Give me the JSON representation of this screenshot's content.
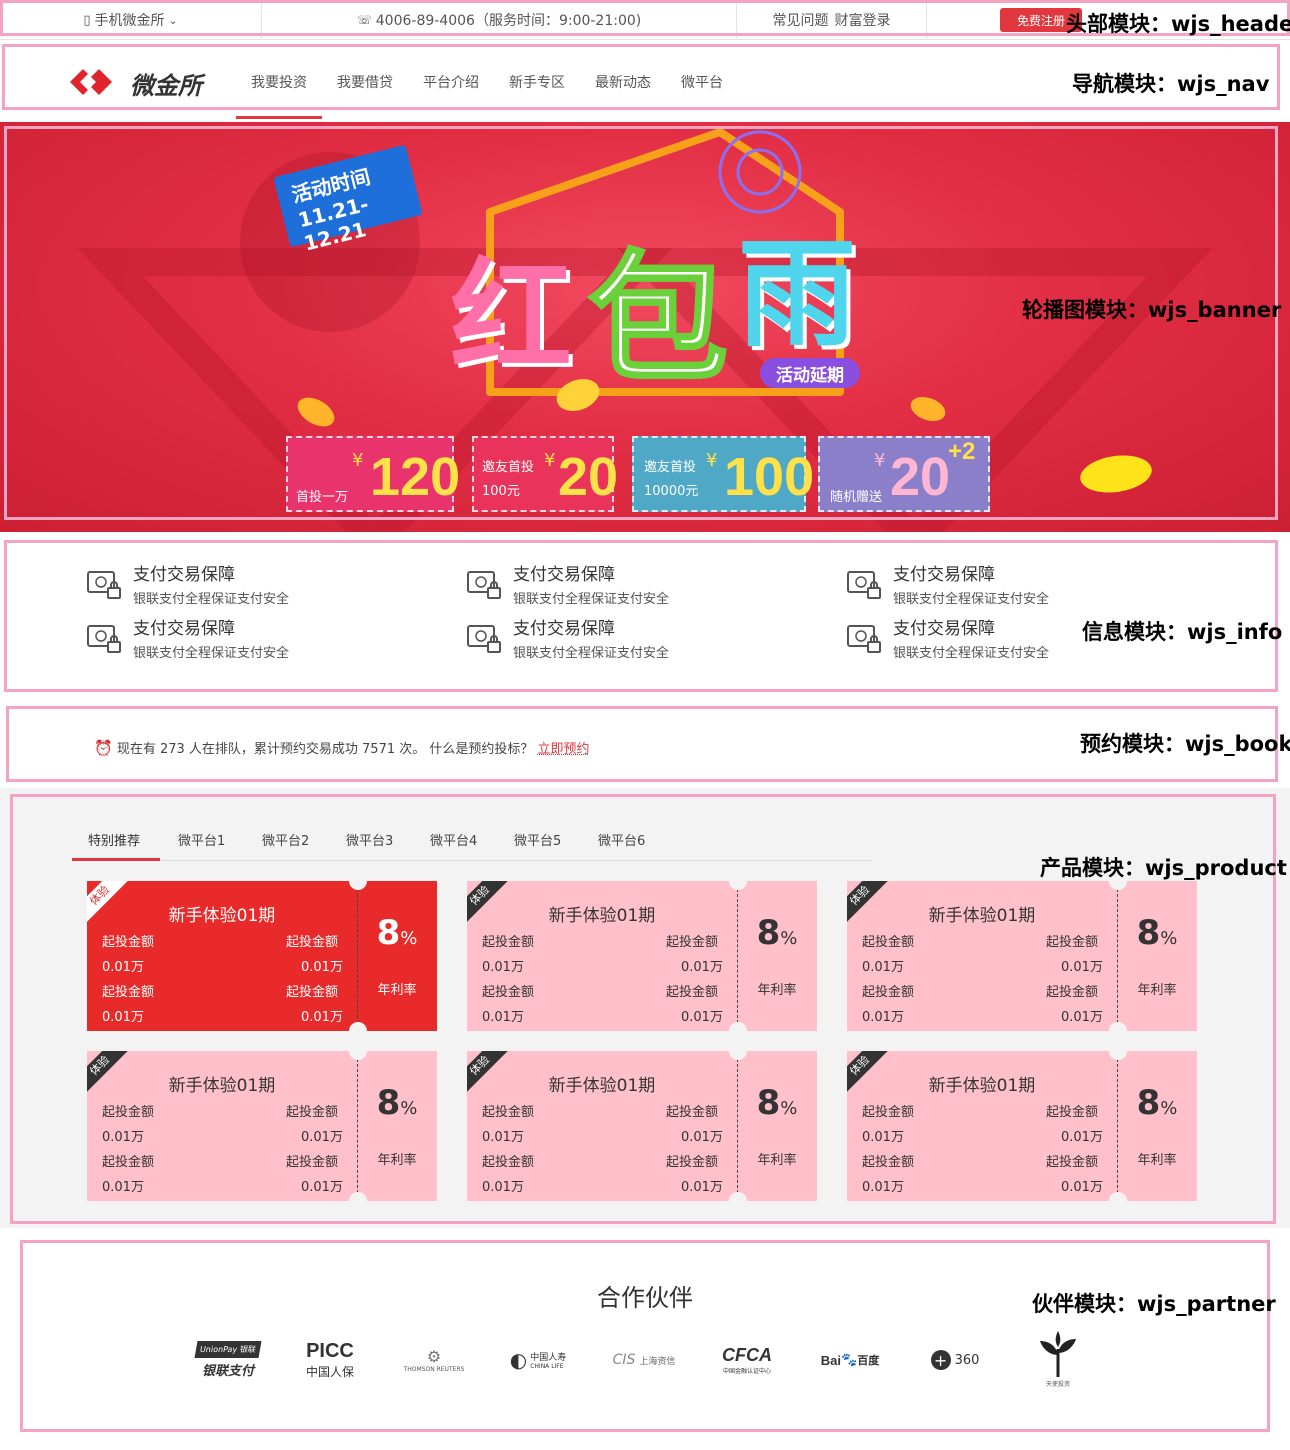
{
  "annotations": {
    "header": "头部模块：wjs_header",
    "nav": "导航模块：wjs_nav",
    "banner": "轮播图模块：wjs_banner",
    "info": "信息模块：wjs_info",
    "book": "预约模块：wjs_book",
    "product": "产品模块：wjs_product",
    "partner": "伙伴模块：wjs_partner"
  },
  "header": {
    "mobile": "手机微金所",
    "phone": "4006-89-4006（服务时间：9:00-21:00)",
    "faq": "常见问题",
    "login": "财富登录",
    "register": "免费注册"
  },
  "nav": {
    "brand": "微金所",
    "items": [
      "我要投资",
      "我要借贷",
      "平台介绍",
      "新手专区",
      "最新动态",
      "微平台"
    ]
  },
  "banner": {
    "time_label": "活动时间",
    "time_range": "11.21-12.21",
    "title_chars": [
      "红",
      "包",
      "雨"
    ],
    "extended": "活动延期",
    "coupons": [
      {
        "label_top": "",
        "label_bottom": "首投一万",
        "yen": "¥",
        "amount": "120",
        "extra": ""
      },
      {
        "label_top": "邀友首投",
        "label_bottom": "100元",
        "yen": "¥",
        "amount": "20",
        "extra": ""
      },
      {
        "label_top": "邀友首投",
        "label_bottom": "10000元",
        "yen": "¥",
        "amount": "100",
        "extra": ""
      },
      {
        "label_top": "",
        "label_bottom": "随机赠送",
        "yen": "¥",
        "amount": "20",
        "extra": "+2"
      }
    ],
    "colors": {
      "bg": "#e22e44",
      "coupon1": "#e8336c",
      "coupon2": "#e9335a",
      "coupon3": "#4fa9c6",
      "coupon4": "#8b7fc9"
    }
  },
  "info": {
    "items": [
      {
        "title": "支付交易保障",
        "desc": "银联支付全程保证支付安全",
        "icon": "safe-payment-icon"
      },
      {
        "title": "支付交易保障",
        "desc": "银联支付全程保证支付安全",
        "icon": "safe-payment-icon"
      },
      {
        "title": "支付交易保障",
        "desc": "银联支付全程保证支付安全",
        "icon": "safe-payment-icon"
      },
      {
        "title": "支付交易保障",
        "desc": "银联支付全程保证支付安全",
        "icon": "safe-payment-icon"
      },
      {
        "title": "支付交易保障",
        "desc": "银联支付全程保证支付安全",
        "icon": "safe-payment-icon"
      },
      {
        "title": "支付交易保障",
        "desc": "银联支付全程保证支付安全",
        "icon": "safe-payment-icon"
      }
    ]
  },
  "book": {
    "text": "现在有 273 人在排队，累计预约交易成功 7571 次。 什么是预约投标？",
    "link": "立即预约"
  },
  "product": {
    "tabs": [
      "特别推荐",
      "微平台1",
      "微平台2",
      "微平台3",
      "微平台4",
      "微平台5",
      "微平台6"
    ],
    "cards": [
      {
        "ribbon": "体验",
        "title": "新手体验01期",
        "l1": "起投金额",
        "r1": "起投金额",
        "l2": "0.01万",
        "r2": "0.01万",
        "l3": "起投金额",
        "r3": "起投金额",
        "l4": "0.01万",
        "r4": "0.01万",
        "rate": "8",
        "pct": "%",
        "rate_label": "年利率"
      },
      {
        "ribbon": "体验",
        "title": "新手体验01期",
        "l1": "起投金额",
        "r1": "起投金额",
        "l2": "0.01万",
        "r2": "0.01万",
        "l3": "起投金额",
        "r3": "起投金额",
        "l4": "0.01万",
        "r4": "0.01万",
        "rate": "8",
        "pct": "%",
        "rate_label": "年利率"
      },
      {
        "ribbon": "体验",
        "title": "新手体验01期",
        "l1": "起投金额",
        "r1": "起投金额",
        "l2": "0.01万",
        "r2": "0.01万",
        "l3": "起投金额",
        "r3": "起投金额",
        "l4": "0.01万",
        "r4": "0.01万",
        "rate": "8",
        "pct": "%",
        "rate_label": "年利率"
      },
      {
        "ribbon": "体验",
        "title": "新手体验01期",
        "l1": "起投金额",
        "r1": "起投金额",
        "l2": "0.01万",
        "r2": "0.01万",
        "l3": "起投金额",
        "r3": "起投金额",
        "l4": "0.01万",
        "r4": "0.01万",
        "rate": "8",
        "pct": "%",
        "rate_label": "年利率"
      },
      {
        "ribbon": "体验",
        "title": "新手体验01期",
        "l1": "起投金额",
        "r1": "起投金额",
        "l2": "0.01万",
        "r2": "0.01万",
        "l3": "起投金额",
        "r3": "起投金额",
        "l4": "0.01万",
        "r4": "0.01万",
        "rate": "8",
        "pct": "%",
        "rate_label": "年利率"
      },
      {
        "ribbon": "体验",
        "title": "新手体验01期",
        "l1": "起投金额",
        "r1": "起投金额",
        "l2": "0.01万",
        "r2": "0.01万",
        "l3": "起投金额",
        "r3": "起投金额",
        "l4": "0.01万",
        "r4": "0.01万",
        "rate": "8",
        "pct": "%",
        "rate_label": "年利率"
      }
    ]
  },
  "partner": {
    "title": "合作伙伴",
    "logos": [
      {
        "top": "UnionPay 银联",
        "bottom": "银联支付"
      },
      {
        "top": "PICC",
        "bottom": "中国人保"
      },
      {
        "top": "⚙",
        "bottom": "THOMSON REUTERS"
      },
      {
        "top": "中国人寿",
        "bottom": "CHINA LIFE"
      },
      {
        "top": "CIS",
        "bottom": "上海资信"
      },
      {
        "top": "CFCA",
        "bottom": "中国金融认证中心"
      },
      {
        "top": "Bai",
        "bottom": "百度"
      },
      {
        "top": "360",
        "bottom": ""
      },
      {
        "top": "",
        "bottom": "天使投资"
      }
    ]
  }
}
